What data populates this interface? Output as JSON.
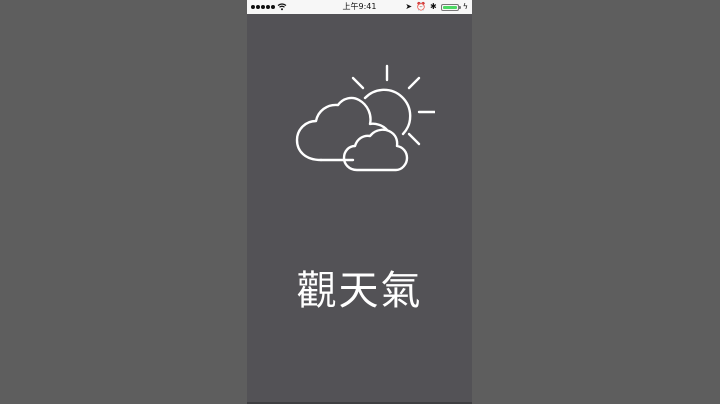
{
  "status_bar": {
    "time": "上午9:41",
    "battery_level": 1.0,
    "battery_color": "#4cd964",
    "icons": [
      "signal-dots",
      "wifi-icon",
      "location-icon",
      "alarm-icon",
      "bluetooth-icon",
      "battery-icon",
      "charging-icon"
    ]
  },
  "splash": {
    "title": "觀天氣",
    "icon": "partly-cloudy-icon",
    "background": "#535256",
    "foreground": "#ffffff"
  }
}
